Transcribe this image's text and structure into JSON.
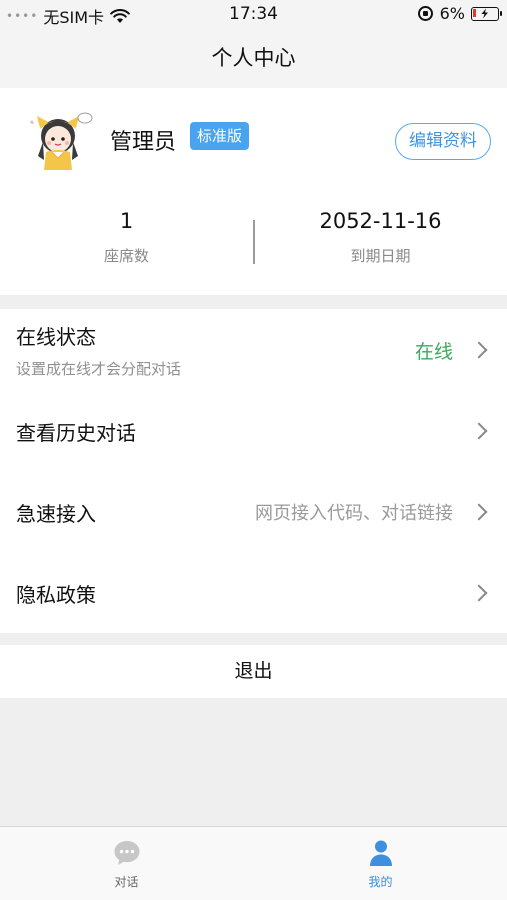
{
  "status_bar": {
    "carrier": "无SIM卡",
    "time": "17:34",
    "battery": "6%"
  },
  "header": {
    "title": "个人中心"
  },
  "profile": {
    "name": "管理员",
    "badge": "标准版",
    "edit_label": "编辑资料",
    "stats": [
      {
        "value": "1",
        "label": "座席数"
      },
      {
        "value": "2052-11-16",
        "label": "到期日期"
      }
    ]
  },
  "menu": {
    "items": [
      {
        "title": "在线状态",
        "subtitle": "设置成在线才会分配对话",
        "value": "在线"
      },
      {
        "title": "查看历史对话"
      },
      {
        "title": "急速接入",
        "value": "网页接入代码、对话链接"
      },
      {
        "title": "隐私政策"
      }
    ]
  },
  "logout_label": "退出",
  "tab_bar": {
    "tabs": [
      {
        "label": "对话",
        "icon": "chat-bubble-icon",
        "active": false
      },
      {
        "label": "我的",
        "icon": "person-icon",
        "active": true
      }
    ]
  },
  "colors": {
    "accent": "#4aa3ee",
    "online": "#3aaa5c",
    "background": "#efefef"
  }
}
